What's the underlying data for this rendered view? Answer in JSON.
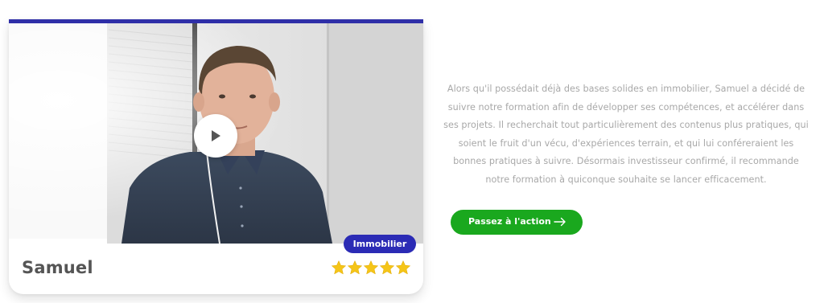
{
  "testimonial": {
    "person_name": "Samuel",
    "tag": "Immobilier",
    "rating": {
      "value": 5,
      "max": 5
    },
    "play_icon": "play-icon",
    "accent_color": "#2f2fa8",
    "badge_color": "#2b2bb5",
    "star_color": "#f5c518"
  },
  "content": {
    "description": "Alors qu'il possédait déjà des bases solides en immobilier, Samuel a décidé de suivre notre formation afin de développer ses compétences, et accélérer dans ses projets. Il recherchait tout particulièrement des contenus plus pratiques, qui soient le fruit d'un vécu, d'expériences terrain, et qui lui conféreraient les bonnes pratiques à suivre. Désormais investisseur confirmé, il recommande notre formation à quiconque souhaite se lancer efficacement.",
    "cta_label": "Passez à l'action",
    "cta_icon": "arrow-right-icon",
    "cta_color": "#1aa81e"
  }
}
